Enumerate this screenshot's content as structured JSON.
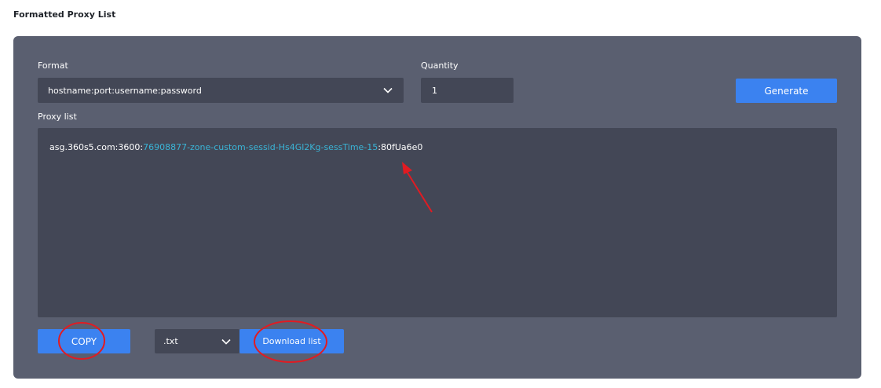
{
  "section": {
    "title": "Formatted Proxy List"
  },
  "form": {
    "format_label": "Format",
    "format_value": "hostname:port:username:password",
    "quantity_label": "Quantity",
    "quantity_value": "1",
    "generate_label": "Generate",
    "proxy_list_label": "Proxy list"
  },
  "proxy": {
    "host_port": "asg.360s5.com:3600:",
    "username": "76908877-zone-custom-sessid-Hs4Gl2Kg-sessTime-15",
    "password": ":80fUa6e0"
  },
  "actions": {
    "copy_label": "COPY",
    "file_type_value": ".txt",
    "download_label": "Download list"
  },
  "colors": {
    "panel": "#5a5f70",
    "field": "#434756",
    "accent": "#3b82f0",
    "username_highlight": "#3ab4d6",
    "annotation": "#e11b22"
  },
  "icons": {
    "format_dropdown": "chevron-down-icon",
    "file_type_dropdown": "chevron-down-icon"
  }
}
